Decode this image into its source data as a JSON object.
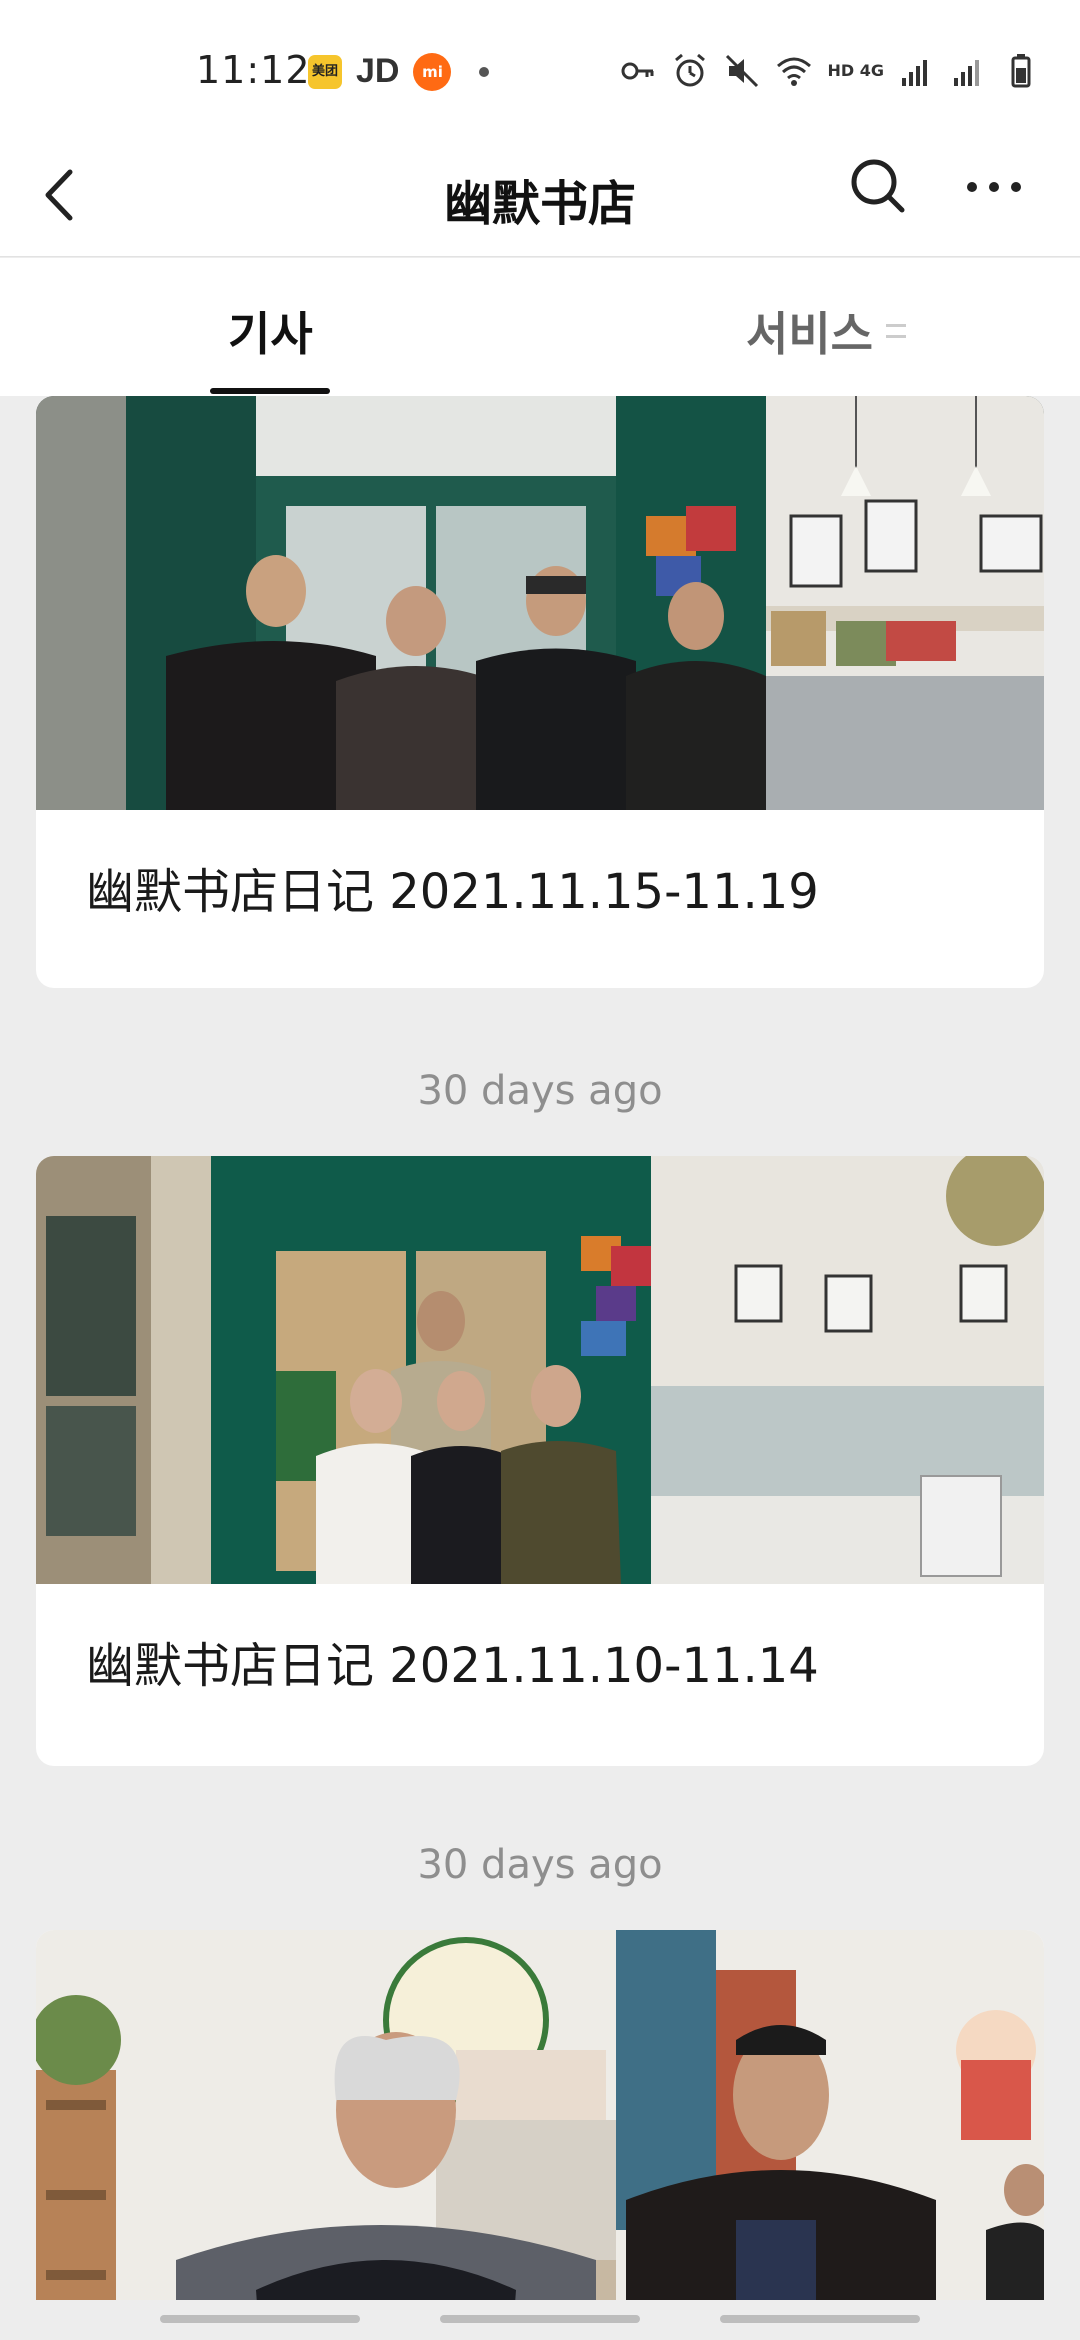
{
  "status_bar": {
    "time": "11:12",
    "app_icons": [
      "meituan-icon",
      "jd-icon",
      "mi-icon"
    ],
    "meituan_text": "美团",
    "jd_text": "JD",
    "mi_text": "mi",
    "network": "HD 4G",
    "right_icons": [
      "key-icon",
      "alarm-icon",
      "mute-icon",
      "wifi-icon",
      "signal-icon",
      "battery-icon"
    ]
  },
  "header": {
    "title": "幽默书店"
  },
  "tabs": [
    {
      "label": "기사",
      "active": true
    },
    {
      "label": "서비스",
      "active": false
    }
  ],
  "feed": {
    "articles": [
      {
        "caption": "幽默书店日记 2021.11.15-11.19"
      },
      {
        "caption": "幽默书店日记 2021.11.10-11.14",
        "timestamp": "30 days ago"
      },
      {
        "caption": "",
        "timestamp": "30 days ago"
      }
    ]
  },
  "colors": {
    "background": "#ededed",
    "card": "#ffffff",
    "storefront_green": "#0f5b4a",
    "timestamp": "#8e8e8e"
  }
}
